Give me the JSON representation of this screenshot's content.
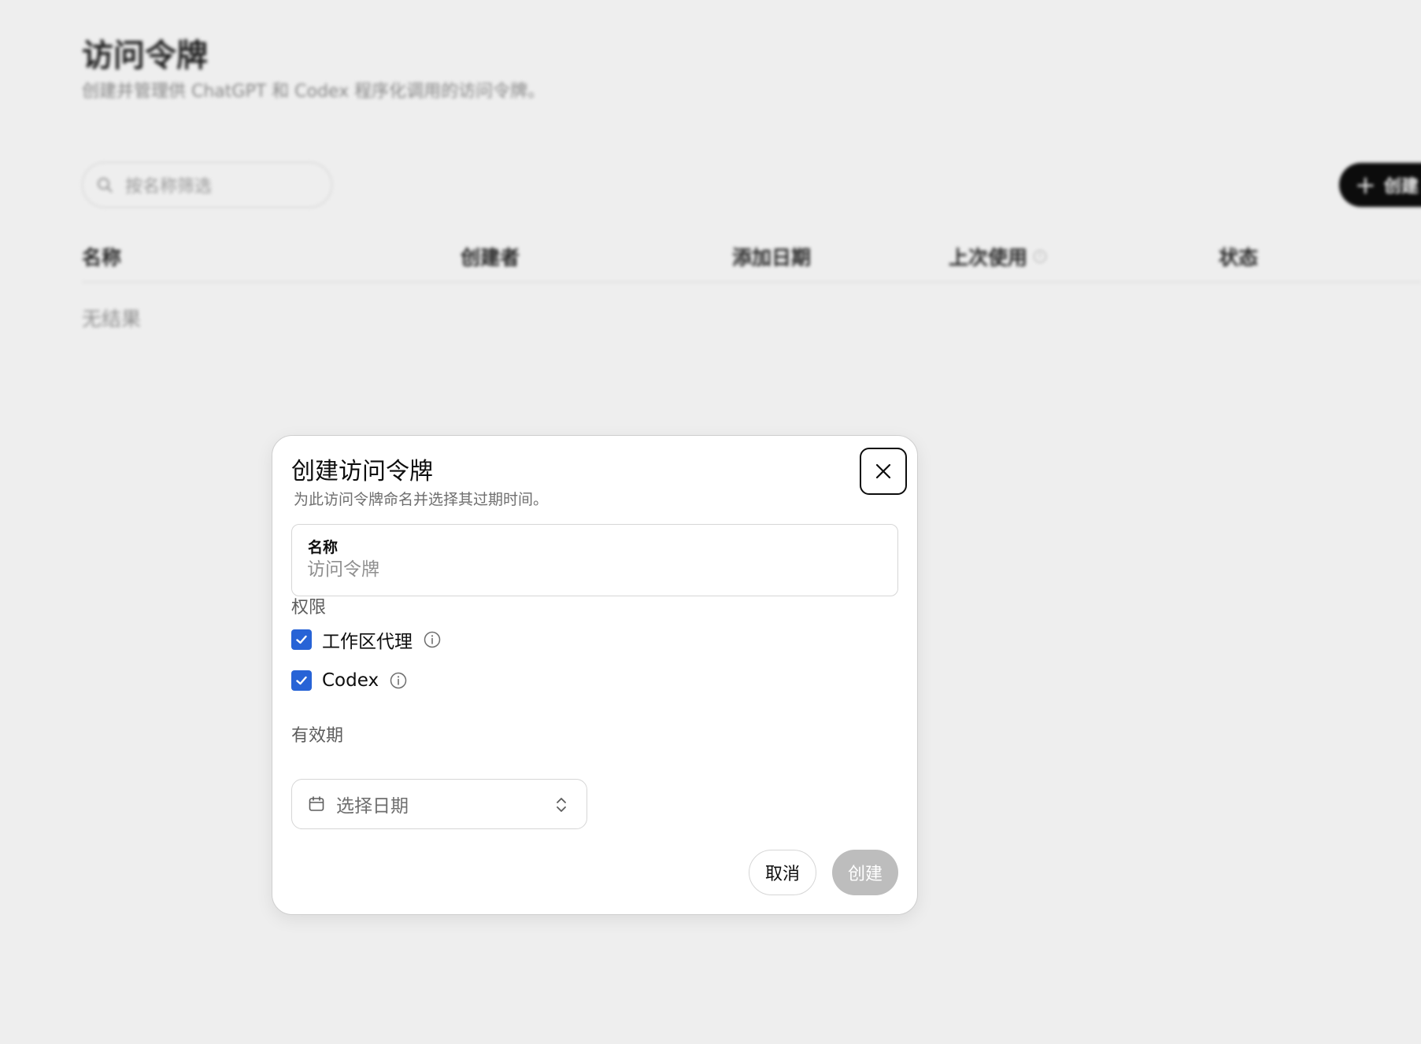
{
  "page": {
    "title": "访问令牌",
    "subtitle": "创建并管理供 ChatGPT 和 Codex 程序化调用的访问令牌。",
    "search_placeholder": "按名称筛选",
    "create_button_label": "创建",
    "table": {
      "columns": [
        "名称",
        "创建者",
        "添加日期",
        "上次使用",
        "状态"
      ],
      "empty_text": "无结果"
    }
  },
  "dialog": {
    "title": "创建访问令牌",
    "description": "为此访问令牌命名并选择其过期时间。",
    "name_field": {
      "label": "名称",
      "placeholder": "访问令牌",
      "value": ""
    },
    "permissions": {
      "label": "权限",
      "items": [
        {
          "label": "工作区代理",
          "checked": true,
          "icon": "info-icon"
        },
        {
          "label": "Codex",
          "checked": true,
          "icon": "info-icon"
        }
      ]
    },
    "expiry": {
      "label": "有效期",
      "placeholder": "选择日期",
      "icons": [
        "calendar-icon",
        "chevron-up-down-icon"
      ]
    },
    "cancel_label": "取消",
    "create_label": "创建",
    "close_icon": "close-icon"
  },
  "colors": {
    "accent": "#2763d6",
    "disabled_button": "#bdbdbd",
    "primary_button": "#0d0d0d"
  }
}
